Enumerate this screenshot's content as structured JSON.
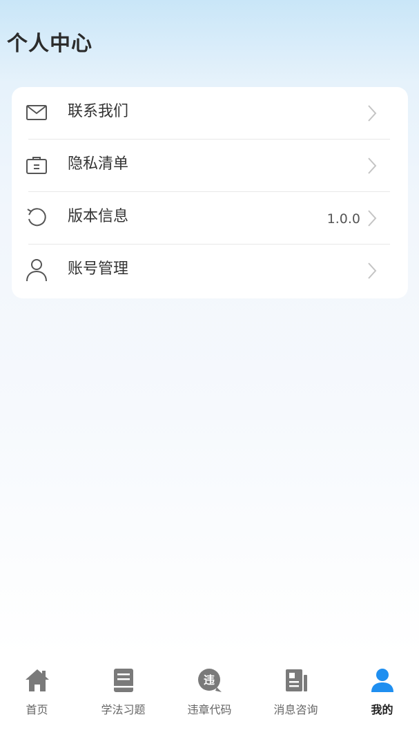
{
  "header": {
    "title": "个人中心"
  },
  "menu": {
    "items": [
      {
        "label": "联系我们",
        "value": "",
        "icon": "mail-icon"
      },
      {
        "label": "隐私清单",
        "value": "",
        "icon": "briefcase-list-icon"
      },
      {
        "label": "版本信息",
        "value": "1.0.0",
        "icon": "refresh-icon"
      },
      {
        "label": "账号管理",
        "value": "",
        "icon": "user-outline-icon"
      }
    ]
  },
  "tabbar": {
    "items": [
      {
        "label": "首页",
        "icon": "home-icon"
      },
      {
        "label": "学法习题",
        "icon": "book-icon"
      },
      {
        "label": "违章代码",
        "icon": "violation-chat-icon",
        "icon_text": "违"
      },
      {
        "label": "消息咨询",
        "icon": "newspaper-icon"
      },
      {
        "label": "我的",
        "icon": "user-icon"
      }
    ],
    "active_index": 4
  },
  "colors": {
    "accent": "#1f8ff0",
    "inactive_icon": "#7a7a7a",
    "title": "#2b2b2b"
  }
}
